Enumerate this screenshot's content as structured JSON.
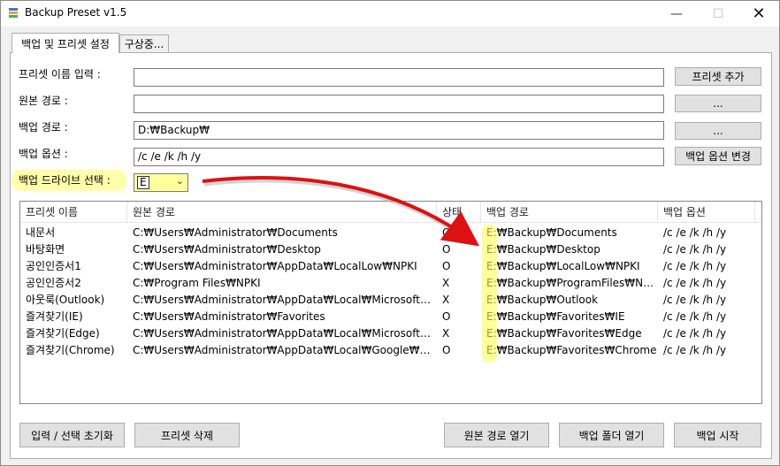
{
  "window": {
    "title": "Backup Preset v1.5",
    "controls": {
      "minimize": "—",
      "maximize": "☐",
      "close": "✕"
    }
  },
  "tabs": [
    {
      "label": "백업 및 프리셋 설정",
      "active": true
    },
    {
      "label": "구상중...",
      "active": false
    }
  ],
  "form": {
    "preset_name_label": "프리셋 이름 입력 :",
    "preset_name_value": "",
    "add_preset_button": "프리셋 추가",
    "source_path_label": "원본 경로 :",
    "source_path_value": "",
    "source_browse_button": "...",
    "backup_path_label": "백업 경로 :",
    "backup_path_value": "D:₩Backup₩",
    "backup_browse_button": "...",
    "backup_options_label": "백업 옵션 :",
    "backup_options_value": "/c /e /k /h /y",
    "change_options_button": "백업 옵션 변경",
    "drive_select_label": "백업 드라이브 선택 :",
    "drive_select_value": "E"
  },
  "table": {
    "columns": [
      "프리셋 이름",
      "원본 경로",
      "상태",
      "백업 경로",
      "백업 옵션"
    ],
    "rows": [
      [
        "내문서",
        "C:₩Users₩Administrator₩Documents",
        "O",
        "E:₩Backup₩Documents",
        "/c /e /k /h /y"
      ],
      [
        "바탕화면",
        "C:₩Users₩Administrator₩Desktop",
        "O",
        "E:₩Backup₩Desktop",
        "/c /e /k /h /y"
      ],
      [
        "공인인증서1",
        "C:₩Users₩Administrator₩AppData₩LocalLow₩NPKI",
        "O",
        "E:₩Backup₩LocalLow₩NPKI",
        "/c /e /k /h /y"
      ],
      [
        "공인인증서2",
        "C:₩Program Files₩NPKI",
        "X",
        "E:₩Backup₩ProgramFiles₩NPKI",
        "/c /e /k /h /y"
      ],
      [
        "아웃룩(Outlook)",
        "C:₩Users₩Administrator₩AppData₩Local₩Microsoft₩Outlook",
        "X",
        "E:₩Backup₩Outlook",
        "/c /e /k /h /y"
      ],
      [
        "즐겨찾기(IE)",
        "C:₩Users₩Administrator₩Favorites",
        "O",
        "E:₩Backup₩Favorites₩IE",
        "/c /e /k /h /y"
      ],
      [
        "즐겨찾기(Edge)",
        "C:₩Users₩Administrator₩AppData₩Local₩Microsoft₩Edge₩...",
        "X",
        "E:₩Backup₩Favorites₩Edge",
        "/c /e /k /h /y"
      ],
      [
        "즐겨찾기(Chrome)",
        "C:₩Users₩Administrator₩AppData₩Local₩Google₩Chrome...",
        "O",
        "E:₩Backup₩Favorites₩Chrome",
        "/c /e /k /h /y"
      ]
    ]
  },
  "footer": {
    "reset_button": "입력 / 선택 초기화",
    "delete_preset_button": "프리셋 삭제",
    "open_source_button": "원본 경로 열기",
    "open_backup_button": "백업 폴더 열기",
    "start_backup_button": "백업 시작"
  },
  "colors": {
    "highlight": "#ffff66",
    "arrow": "#dd1111",
    "window_bg": "#f0f0f0",
    "button_bg": "#e1e1e1"
  },
  "icons": {
    "app": "app-icon",
    "dropdown": "chevron-down-icon"
  }
}
